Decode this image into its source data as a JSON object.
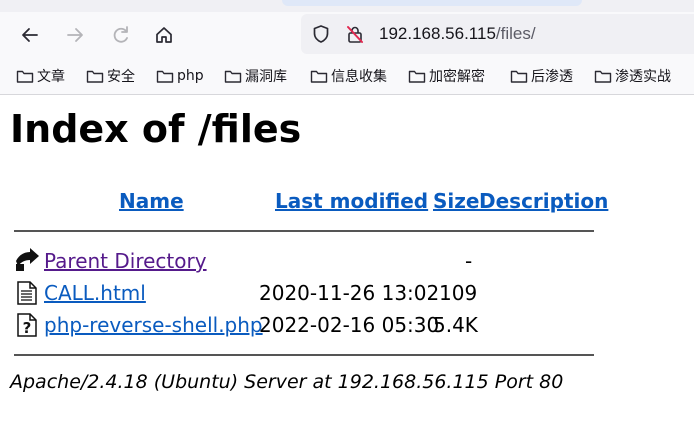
{
  "browser": {
    "url_host": "192.168.56.115",
    "url_path": "/files/",
    "nav_icons": [
      "back-arrow-icon",
      "forward-arrow-icon",
      "reload-icon",
      "home-icon",
      "shield-icon",
      "insecure-lock-icon"
    ],
    "bookmarks": [
      {
        "label": "文章",
        "icon": "folder-icon"
      },
      {
        "label": "安全",
        "icon": "folder-icon"
      },
      {
        "label": "php",
        "icon": "folder-icon"
      },
      {
        "label": "漏洞库",
        "icon": "folder-icon"
      },
      {
        "label": "信息收集",
        "icon": "folder-icon"
      },
      {
        "label": "加密解密",
        "icon": "folder-icon"
      },
      {
        "label": "后渗透",
        "icon": "folder-icon"
      },
      {
        "label": "渗透实战",
        "icon": "folder-icon"
      }
    ]
  },
  "page": {
    "title": "Index of /files",
    "columns": {
      "name": "Name",
      "last_modified": "Last modified",
      "size": "Size",
      "description": "Description"
    },
    "entries": [
      {
        "name": "Parent Directory",
        "modified": "",
        "size": "-",
        "icon": "back-folder-icon",
        "visited": true
      },
      {
        "name": "CALL.html",
        "modified": "2020-11-26 13:02",
        "size": "109",
        "icon": "text-file-icon",
        "visited": false
      },
      {
        "name": "php-reverse-shell.php",
        "modified": "2022-02-16 05:30",
        "size": "5.4K",
        "icon": "unknown-file-icon",
        "visited": false
      }
    ],
    "footer": "Apache/2.4.18 (Ubuntu) Server at 192.168.56.115 Port 80"
  },
  "colors": {
    "link": "#0a5bbf",
    "visited_link": "#551a8b",
    "chrome_bg": "#f9f9fb"
  }
}
